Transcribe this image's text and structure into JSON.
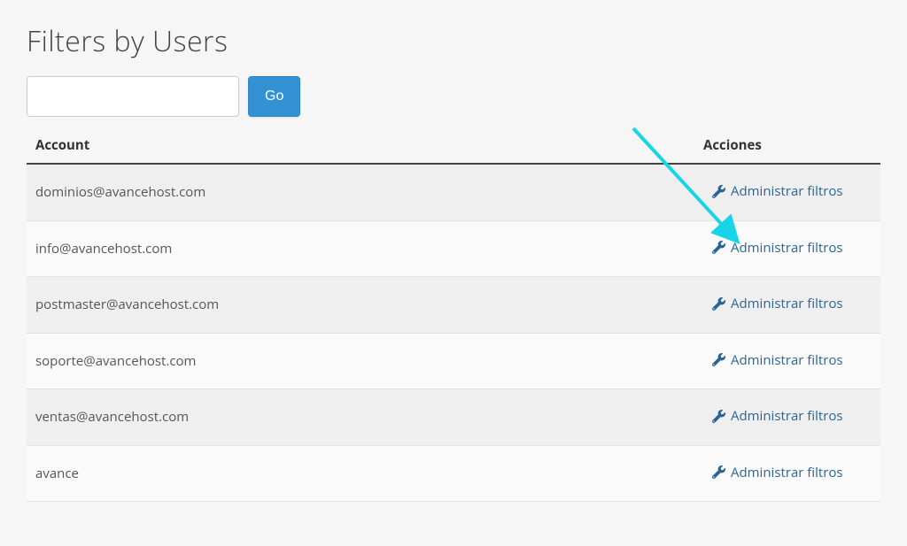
{
  "title": "Filters by Users",
  "search": {
    "value": "",
    "placeholder": ""
  },
  "goLabel": "Go",
  "columns": {
    "account": "Account",
    "actions": "Acciones"
  },
  "actionLabel": "Administrar filtros",
  "rows": [
    {
      "account": "dominios@avancehost.com"
    },
    {
      "account": "info@avancehost.com"
    },
    {
      "account": "postmaster@avancehost.com"
    },
    {
      "account": "soporte@avancehost.com"
    },
    {
      "account": "ventas@avancehost.com"
    },
    {
      "account": "avance"
    }
  ],
  "colors": {
    "link": "#2a6496",
    "button": "#3492d4",
    "arrow": "#18d4e8"
  }
}
